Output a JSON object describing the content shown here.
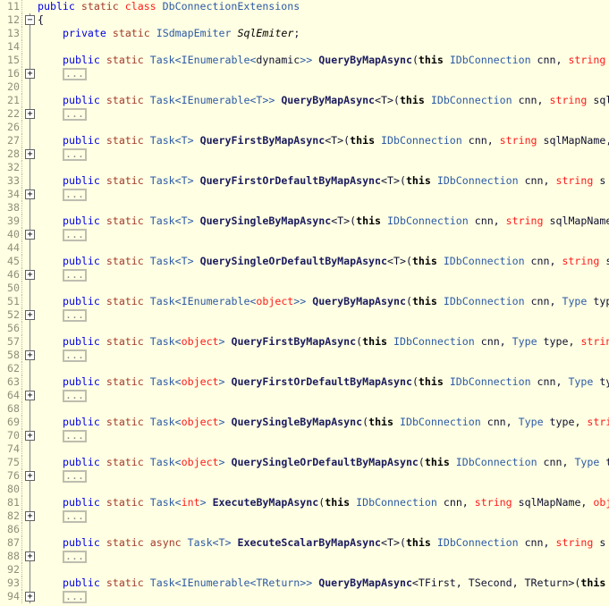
{
  "colors": {
    "background": "#ffffe3",
    "keyword": "#0000e6",
    "modifier": "#a33a2a",
    "builtin": "#ff1a1a",
    "type": "#2c5aa6",
    "method": "#1b1b5e"
  },
  "collapsed_label": "...",
  "lines": [
    {
      "n": "11",
      "kind": "code",
      "indent": 0,
      "tokens": [
        [
          "public",
          "k"
        ],
        [
          " ",
          "p"
        ],
        [
          "static",
          "s"
        ],
        [
          " ",
          "p"
        ],
        [
          "class",
          "r"
        ],
        [
          " DbConnectionExtensions",
          "t"
        ]
      ]
    },
    {
      "n": "12",
      "kind": "open",
      "indent": 0,
      "tokens": [
        [
          "{",
          "p"
        ]
      ]
    },
    {
      "n": "13",
      "kind": "code",
      "indent": 1,
      "tokens": [
        [
          "private",
          "k"
        ],
        [
          " ",
          "p"
        ],
        [
          "static",
          "s"
        ],
        [
          " ISdmapEmiter ",
          "t"
        ],
        [
          "SqlEmiter",
          "i"
        ],
        [
          ";",
          "p"
        ]
      ]
    },
    {
      "n": "14",
      "kind": "blank"
    },
    {
      "n": "15",
      "kind": "code",
      "indent": 1,
      "tokens": [
        [
          "public",
          "k"
        ],
        [
          " ",
          "p"
        ],
        [
          "static",
          "s"
        ],
        [
          " Task<IEnumerable<",
          "t"
        ],
        [
          "dynamic",
          "p"
        ],
        [
          ">> ",
          "t"
        ],
        [
          "QueryByMapAsync",
          "m"
        ],
        [
          "(",
          "p"
        ],
        [
          "this",
          "b"
        ],
        [
          " IDbConnection ",
          "t"
        ],
        [
          "cnn, ",
          "p"
        ],
        [
          "string",
          "r"
        ]
      ]
    },
    {
      "n": "16",
      "kind": "fold"
    },
    {
      "n": "20",
      "kind": "blank"
    },
    {
      "n": "21",
      "kind": "code",
      "indent": 1,
      "tokens": [
        [
          "public",
          "k"
        ],
        [
          " ",
          "p"
        ],
        [
          "static",
          "s"
        ],
        [
          " Task<IEnumerable<T>> ",
          "t"
        ],
        [
          "QueryByMapAsync",
          "m"
        ],
        [
          "<T>(",
          "p"
        ],
        [
          "this",
          "b"
        ],
        [
          " IDbConnection ",
          "t"
        ],
        [
          "cnn, ",
          "p"
        ],
        [
          "string",
          "r"
        ],
        [
          " sql",
          "p"
        ]
      ]
    },
    {
      "n": "22",
      "kind": "fold"
    },
    {
      "n": "26",
      "kind": "blank"
    },
    {
      "n": "27",
      "kind": "code",
      "indent": 1,
      "tokens": [
        [
          "public",
          "k"
        ],
        [
          " ",
          "p"
        ],
        [
          "static",
          "s"
        ],
        [
          " Task<T> ",
          "t"
        ],
        [
          "QueryFirstByMapAsync",
          "m"
        ],
        [
          "<T>(",
          "p"
        ],
        [
          "this",
          "b"
        ],
        [
          " IDbConnection ",
          "t"
        ],
        [
          "cnn, ",
          "p"
        ],
        [
          "string",
          "r"
        ],
        [
          " sqlMapName,",
          "p"
        ]
      ]
    },
    {
      "n": "28",
      "kind": "fold"
    },
    {
      "n": "32",
      "kind": "blank"
    },
    {
      "n": "33",
      "kind": "code",
      "indent": 1,
      "tokens": [
        [
          "public",
          "k"
        ],
        [
          " ",
          "p"
        ],
        [
          "static",
          "s"
        ],
        [
          " Task<T> ",
          "t"
        ],
        [
          "QueryFirstOrDefaultByMapAsync",
          "m"
        ],
        [
          "<T>(",
          "p"
        ],
        [
          "this",
          "b"
        ],
        [
          " IDbConnection ",
          "t"
        ],
        [
          "cnn, ",
          "p"
        ],
        [
          "string",
          "r"
        ],
        [
          " s",
          "p"
        ]
      ]
    },
    {
      "n": "34",
      "kind": "fold"
    },
    {
      "n": "38",
      "kind": "blank"
    },
    {
      "n": "39",
      "kind": "code",
      "indent": 1,
      "tokens": [
        [
          "public",
          "k"
        ],
        [
          " ",
          "p"
        ],
        [
          "static",
          "s"
        ],
        [
          " Task<T> ",
          "t"
        ],
        [
          "QuerySingleByMapAsync",
          "m"
        ],
        [
          "<T>(",
          "p"
        ],
        [
          "this",
          "b"
        ],
        [
          " IDbConnection ",
          "t"
        ],
        [
          "cnn, ",
          "p"
        ],
        [
          "string",
          "r"
        ],
        [
          " sqlMapName",
          "p"
        ]
      ]
    },
    {
      "n": "40",
      "kind": "fold"
    },
    {
      "n": "44",
      "kind": "blank"
    },
    {
      "n": "45",
      "kind": "code",
      "indent": 1,
      "tokens": [
        [
          "public",
          "k"
        ],
        [
          " ",
          "p"
        ],
        [
          "static",
          "s"
        ],
        [
          " Task<T> ",
          "t"
        ],
        [
          "QuerySingleOrDefaultByMapAsync",
          "m"
        ],
        [
          "<T>(",
          "p"
        ],
        [
          "this",
          "b"
        ],
        [
          " IDbConnection ",
          "t"
        ],
        [
          "cnn, ",
          "p"
        ],
        [
          "string",
          "r"
        ],
        [
          " s",
          "p"
        ]
      ]
    },
    {
      "n": "46",
      "kind": "fold"
    },
    {
      "n": "50",
      "kind": "blank"
    },
    {
      "n": "51",
      "kind": "code",
      "indent": 1,
      "tokens": [
        [
          "public",
          "k"
        ],
        [
          " ",
          "p"
        ],
        [
          "static",
          "s"
        ],
        [
          " Task<IEnumerable<",
          "t"
        ],
        [
          "object",
          "r"
        ],
        [
          ">> ",
          "t"
        ],
        [
          "QueryByMapAsync",
          "m"
        ],
        [
          "(",
          "p"
        ],
        [
          "this",
          "b"
        ],
        [
          " IDbConnection ",
          "t"
        ],
        [
          "cnn, ",
          "p"
        ],
        [
          "Type",
          "t"
        ],
        [
          " typ",
          "p"
        ]
      ]
    },
    {
      "n": "52",
      "kind": "fold"
    },
    {
      "n": "56",
      "kind": "blank"
    },
    {
      "n": "57",
      "kind": "code",
      "indent": 1,
      "tokens": [
        [
          "public",
          "k"
        ],
        [
          " ",
          "p"
        ],
        [
          "static",
          "s"
        ],
        [
          " Task<",
          "t"
        ],
        [
          "object",
          "r"
        ],
        [
          "> ",
          "t"
        ],
        [
          "QueryFirstByMapAsync",
          "m"
        ],
        [
          "(",
          "p"
        ],
        [
          "this",
          "b"
        ],
        [
          " IDbConnection ",
          "t"
        ],
        [
          "cnn, ",
          "p"
        ],
        [
          "Type",
          "t"
        ],
        [
          " type, ",
          "p"
        ],
        [
          "strin",
          "r"
        ]
      ]
    },
    {
      "n": "58",
      "kind": "fold"
    },
    {
      "n": "62",
      "kind": "blank"
    },
    {
      "n": "63",
      "kind": "code",
      "indent": 1,
      "tokens": [
        [
          "public",
          "k"
        ],
        [
          " ",
          "p"
        ],
        [
          "static",
          "s"
        ],
        [
          " Task<",
          "t"
        ],
        [
          "object",
          "r"
        ],
        [
          "> ",
          "t"
        ],
        [
          "QueryFirstOrDefaultByMapAsync",
          "m"
        ],
        [
          "(",
          "p"
        ],
        [
          "this",
          "b"
        ],
        [
          " IDbConnection ",
          "t"
        ],
        [
          "cnn, ",
          "p"
        ],
        [
          "Type",
          "t"
        ],
        [
          " ty",
          "p"
        ]
      ]
    },
    {
      "n": "64",
      "kind": "fold"
    },
    {
      "n": "68",
      "kind": "blank"
    },
    {
      "n": "69",
      "kind": "code",
      "indent": 1,
      "tokens": [
        [
          "public",
          "k"
        ],
        [
          " ",
          "p"
        ],
        [
          "static",
          "s"
        ],
        [
          " Task<",
          "t"
        ],
        [
          "object",
          "r"
        ],
        [
          "> ",
          "t"
        ],
        [
          "QuerySingleByMapAsync",
          "m"
        ],
        [
          "(",
          "p"
        ],
        [
          "this",
          "b"
        ],
        [
          " IDbConnection ",
          "t"
        ],
        [
          "cnn, ",
          "p"
        ],
        [
          "Type",
          "t"
        ],
        [
          " type, ",
          "p"
        ],
        [
          "stri",
          "r"
        ]
      ]
    },
    {
      "n": "70",
      "kind": "fold"
    },
    {
      "n": "74",
      "kind": "blank"
    },
    {
      "n": "75",
      "kind": "code",
      "indent": 1,
      "tokens": [
        [
          "public",
          "k"
        ],
        [
          " ",
          "p"
        ],
        [
          "static",
          "s"
        ],
        [
          " Task<",
          "t"
        ],
        [
          "object",
          "r"
        ],
        [
          "> ",
          "t"
        ],
        [
          "QuerySingleOrDefaultByMapAsync",
          "m"
        ],
        [
          "(",
          "p"
        ],
        [
          "this",
          "b"
        ],
        [
          " IDbConnection ",
          "t"
        ],
        [
          "cnn, ",
          "p"
        ],
        [
          "Type",
          "t"
        ],
        [
          " t",
          "p"
        ]
      ]
    },
    {
      "n": "76",
      "kind": "fold"
    },
    {
      "n": "80",
      "kind": "blank"
    },
    {
      "n": "81",
      "kind": "code",
      "indent": 1,
      "tokens": [
        [
          "public",
          "k"
        ],
        [
          " ",
          "p"
        ],
        [
          "static",
          "s"
        ],
        [
          " Task<",
          "t"
        ],
        [
          "int",
          "r"
        ],
        [
          "> ",
          "t"
        ],
        [
          "ExecuteByMapAsync",
          "m"
        ],
        [
          "(",
          "p"
        ],
        [
          "this",
          "b"
        ],
        [
          " IDbConnection ",
          "t"
        ],
        [
          "cnn, ",
          "p"
        ],
        [
          "string",
          "r"
        ],
        [
          " sqlMapName, ",
          "p"
        ],
        [
          "obj",
          "r"
        ]
      ]
    },
    {
      "n": "82",
      "kind": "fold"
    },
    {
      "n": "86",
      "kind": "blank"
    },
    {
      "n": "87",
      "kind": "code",
      "indent": 1,
      "tokens": [
        [
          "public",
          "k"
        ],
        [
          " ",
          "p"
        ],
        [
          "static",
          "s"
        ],
        [
          " ",
          "p"
        ],
        [
          "async",
          "s"
        ],
        [
          " Task<T> ",
          "t"
        ],
        [
          "ExecuteScalarByMapAsync",
          "m"
        ],
        [
          "<T>(",
          "p"
        ],
        [
          "this",
          "b"
        ],
        [
          " IDbConnection ",
          "t"
        ],
        [
          "cnn, ",
          "p"
        ],
        [
          "string",
          "r"
        ],
        [
          " s",
          "p"
        ]
      ]
    },
    {
      "n": "88",
      "kind": "fold"
    },
    {
      "n": "92",
      "kind": "blank"
    },
    {
      "n": "93",
      "kind": "code",
      "indent": 1,
      "tokens": [
        [
          "public",
          "k"
        ],
        [
          " ",
          "p"
        ],
        [
          "static",
          "s"
        ],
        [
          " Task<IEnumerable<TReturn>> ",
          "t"
        ],
        [
          "QueryByMapAsync",
          "m"
        ],
        [
          "<TFirst, TSecond, TReturn>(",
          "p"
        ],
        [
          "this",
          "b"
        ]
      ]
    },
    {
      "n": "94",
      "kind": "fold"
    }
  ]
}
